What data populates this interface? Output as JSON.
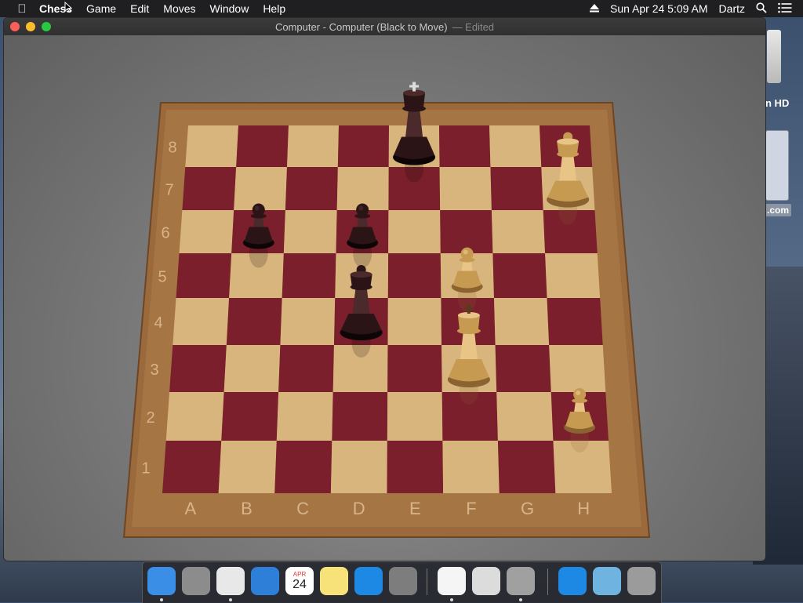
{
  "menubar": {
    "app_name": "Chess",
    "menus": [
      "Game",
      "Edit",
      "Moves",
      "Window",
      "Help"
    ],
    "date_time": "Sun Apr 24  5:09 AM",
    "user": "Dartz"
  },
  "desktop": {
    "drive_label": "n HD",
    "link_label": ".com"
  },
  "window": {
    "title": "Computer - Computer   (Black to Move)",
    "edited": "— Edited"
  },
  "board": {
    "files": [
      "A",
      "B",
      "C",
      "D",
      "E",
      "F",
      "G",
      "H"
    ],
    "ranks": [
      "8",
      "7",
      "6",
      "5",
      "4",
      "3",
      "2",
      "1"
    ],
    "light_color": "#d9b57e",
    "dark_color": "#7a1f2b",
    "frame_color": "#9a6a3c",
    "pieces": [
      {
        "type": "king",
        "color": "black",
        "square": "E8"
      },
      {
        "type": "pawn",
        "color": "black",
        "square": "B6"
      },
      {
        "type": "pawn",
        "color": "black",
        "square": "D6"
      },
      {
        "type": "queen",
        "color": "black",
        "square": "D4"
      },
      {
        "type": "queen",
        "color": "white",
        "square": "H7"
      },
      {
        "type": "pawn",
        "color": "white",
        "square": "F5"
      },
      {
        "type": "king",
        "color": "white",
        "square": "F3"
      },
      {
        "type": "pawn",
        "color": "white",
        "square": "H2"
      }
    ]
  },
  "dock": {
    "apps": [
      {
        "name": "finder-icon",
        "color": "#3a8ee6"
      },
      {
        "name": "launchpad-icon",
        "color": "#8c8c8c"
      },
      {
        "name": "chrome-icon",
        "color": "#e8e8e8"
      },
      {
        "name": "safari-icon",
        "color": "#2e7fd8"
      },
      {
        "name": "calendar-icon",
        "color": "#ffffff",
        "text_month": "APR",
        "text_day": "24"
      },
      {
        "name": "notes-icon",
        "color": "#f7e27a"
      },
      {
        "name": "app-store-icon",
        "color": "#1e88e5"
      },
      {
        "name": "system-preferences-icon",
        "color": "#7d7d7d"
      },
      {
        "name": "itunes-icon",
        "color": "#f5f5f5"
      },
      {
        "name": "preview-icon",
        "color": "#dcdcdc"
      },
      {
        "name": "chess-icon",
        "color": "#a0a0a0"
      },
      {
        "name": "app-store-downloads-icon",
        "color": "#1e88e5"
      },
      {
        "name": "downloads-folder-icon",
        "color": "#6fb3e0"
      },
      {
        "name": "trash-icon",
        "color": "#9b9b9b"
      }
    ]
  }
}
